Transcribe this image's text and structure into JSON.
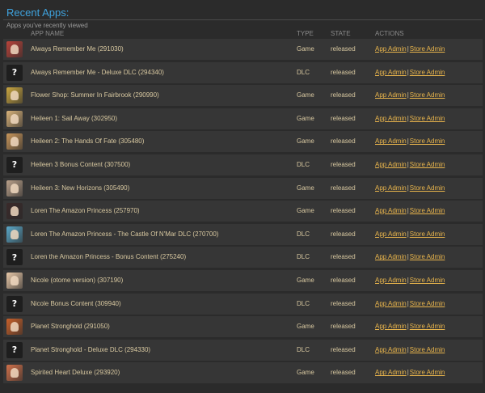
{
  "header": {
    "title": "Recent Apps:",
    "subtitle": "Apps you've recently viewed"
  },
  "columns": {
    "name": "APP NAME",
    "type": "TYPE",
    "state": "STATE",
    "actions": "ACTIONS"
  },
  "action_labels": {
    "app_admin": "App Admin",
    "separator": "|",
    "store_admin": "Store Admin"
  },
  "apps": [
    {
      "name": "Always Remember Me (291030)",
      "type": "Game",
      "state": "released",
      "icon": "game-cover-icon",
      "icon_color": "#b8433a"
    },
    {
      "name": "Always Remember Me - Deluxe DLC (294340)",
      "type": "DLC",
      "state": "released",
      "icon": "placeholder-question-icon",
      "icon_color": "#1e1e1e"
    },
    {
      "name": "Flower Shop: Summer In Fairbrook (290990)",
      "type": "Game",
      "state": "released",
      "icon": "game-cover-icon",
      "icon_color": "#c9a640"
    },
    {
      "name": "Heileen 1: Sail Away (302950)",
      "type": "Game",
      "state": "released",
      "icon": "game-cover-icon",
      "icon_color": "#d8b27a"
    },
    {
      "name": "Heileen 2: The Hands Of Fate (305480)",
      "type": "Game",
      "state": "released",
      "icon": "game-cover-icon",
      "icon_color": "#c7955a"
    },
    {
      "name": "Heileen 3 Bonus Content (307500)",
      "type": "DLC",
      "state": "released",
      "icon": "placeholder-question-icon",
      "icon_color": "#1e1e1e"
    },
    {
      "name": "Heileen 3: New Horizons (305490)",
      "type": "Game",
      "state": "released",
      "icon": "game-cover-icon",
      "icon_color": "#b9a08a"
    },
    {
      "name": "Loren The Amazon Princess (257970)",
      "type": "Game",
      "state": "released",
      "icon": "game-cover-icon",
      "icon_color": "#3a2a2a"
    },
    {
      "name": "Loren The Amazon Princess - The Castle Of N'Mar DLC (270700)",
      "type": "DLC",
      "state": "released",
      "icon": "game-cover-icon",
      "icon_color": "#5aa8c8"
    },
    {
      "name": "Loren the Amazon Princess - Bonus Content (275240)",
      "type": "DLC",
      "state": "released",
      "icon": "placeholder-question-icon",
      "icon_color": "#1e1e1e"
    },
    {
      "name": "Nicole (otome version) (307190)",
      "type": "Game",
      "state": "released",
      "icon": "game-cover-icon",
      "icon_color": "#e8c8a8"
    },
    {
      "name": "Nicole Bonus Content (309940)",
      "type": "DLC",
      "state": "released",
      "icon": "placeholder-question-icon",
      "icon_color": "#1e1e1e"
    },
    {
      "name": "Planet Stronghold (291050)",
      "type": "Game",
      "state": "released",
      "icon": "game-cover-icon",
      "icon_color": "#c8602a"
    },
    {
      "name": "Planet Stronghold - Deluxe DLC (294330)",
      "type": "DLC",
      "state": "released",
      "icon": "placeholder-question-icon",
      "icon_color": "#1e1e1e"
    },
    {
      "name": "Spirited Heart Deluxe (293920)",
      "type": "Game",
      "state": "released",
      "icon": "game-cover-icon",
      "icon_color": "#d0704a"
    }
  ]
}
